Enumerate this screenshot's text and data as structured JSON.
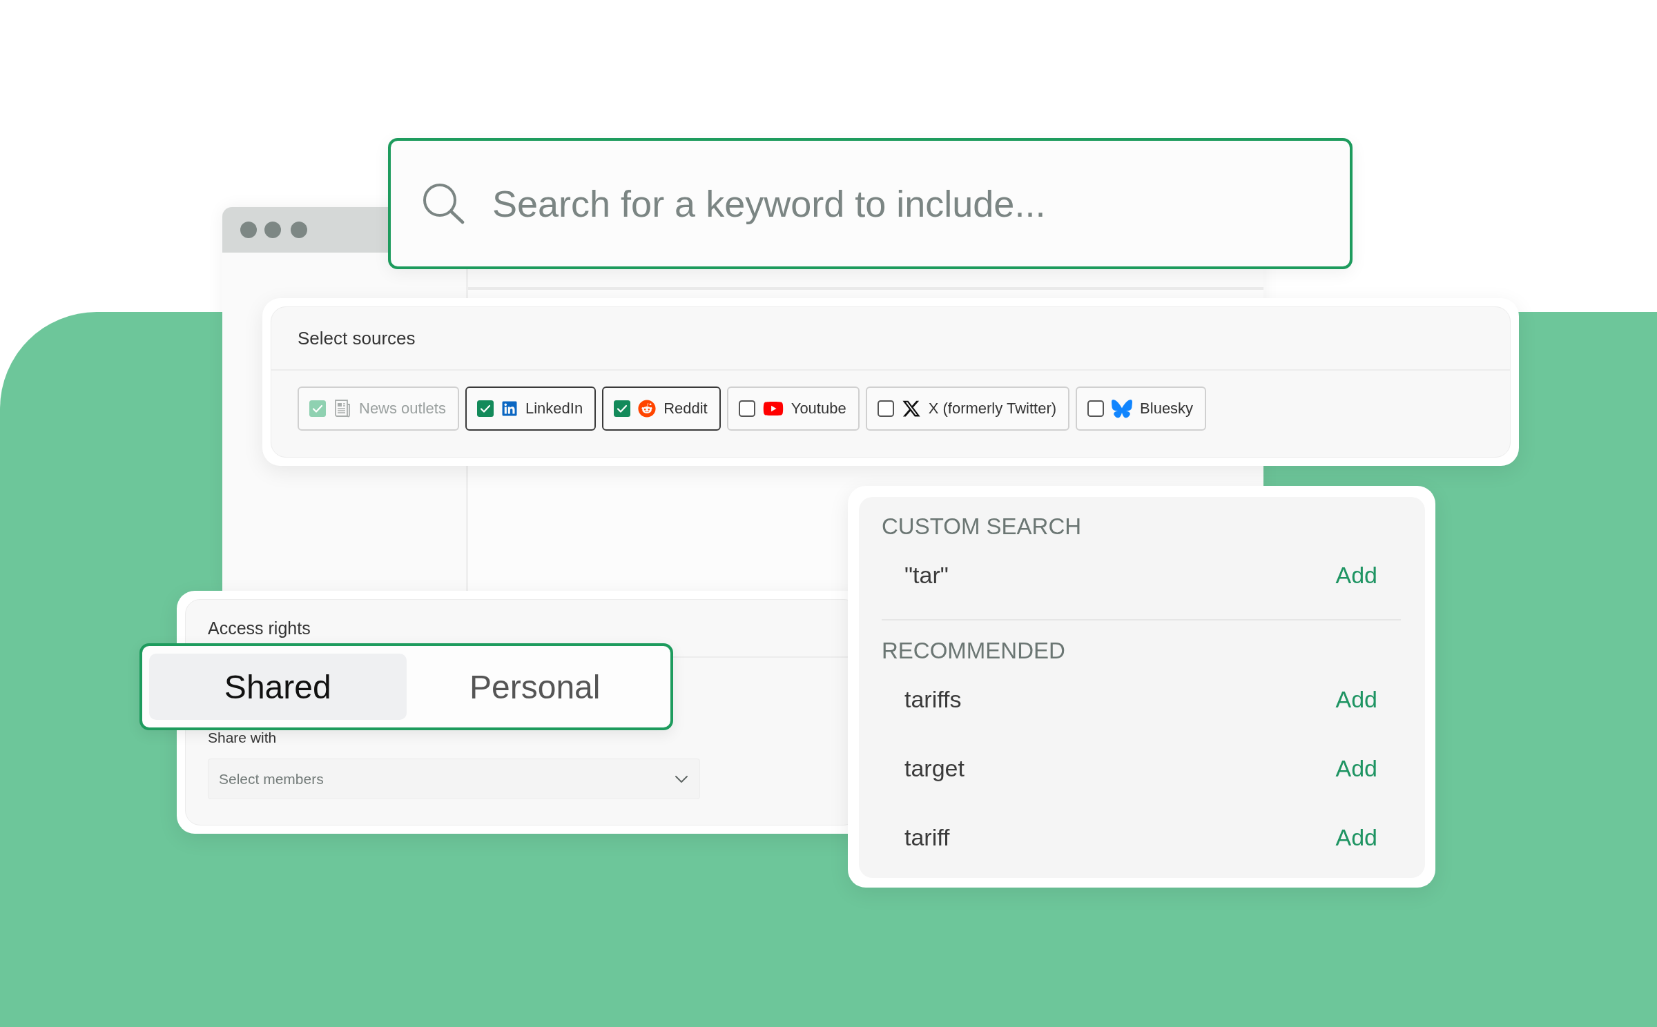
{
  "search": {
    "placeholder": "Search for a keyword to include..."
  },
  "sources": {
    "title": "Select sources",
    "items": [
      {
        "kind": "news",
        "label": "News outlets",
        "checked": true,
        "disabled": true
      },
      {
        "kind": "linkedin",
        "label": "LinkedIn",
        "checked": true,
        "disabled": false
      },
      {
        "kind": "reddit",
        "label": "Reddit",
        "checked": true,
        "disabled": false
      },
      {
        "kind": "youtube",
        "label": "Youtube",
        "checked": false,
        "disabled": false
      },
      {
        "kind": "x",
        "label": "X (formerly Twitter)",
        "checked": false,
        "disabled": false
      },
      {
        "kind": "bluesky",
        "label": "Bluesky",
        "checked": false,
        "disabled": false
      }
    ]
  },
  "access": {
    "title": "Access rights",
    "options": [
      {
        "label": "Shared",
        "selected": true
      },
      {
        "label": "Personal",
        "selected": false
      }
    ],
    "share_with": {
      "label": "Share with",
      "placeholder": "Select members"
    }
  },
  "suggestions": {
    "sections": [
      {
        "heading": "CUSTOM SEARCH",
        "items": [
          {
            "term": "\"tar\"",
            "action": "Add"
          }
        ]
      },
      {
        "heading": "RECOMMENDED",
        "items": [
          {
            "term": "tariffs",
            "action": "Add"
          },
          {
            "term": "target",
            "action": "Add"
          },
          {
            "term": "tariff",
            "action": "Add"
          }
        ]
      }
    ]
  }
}
